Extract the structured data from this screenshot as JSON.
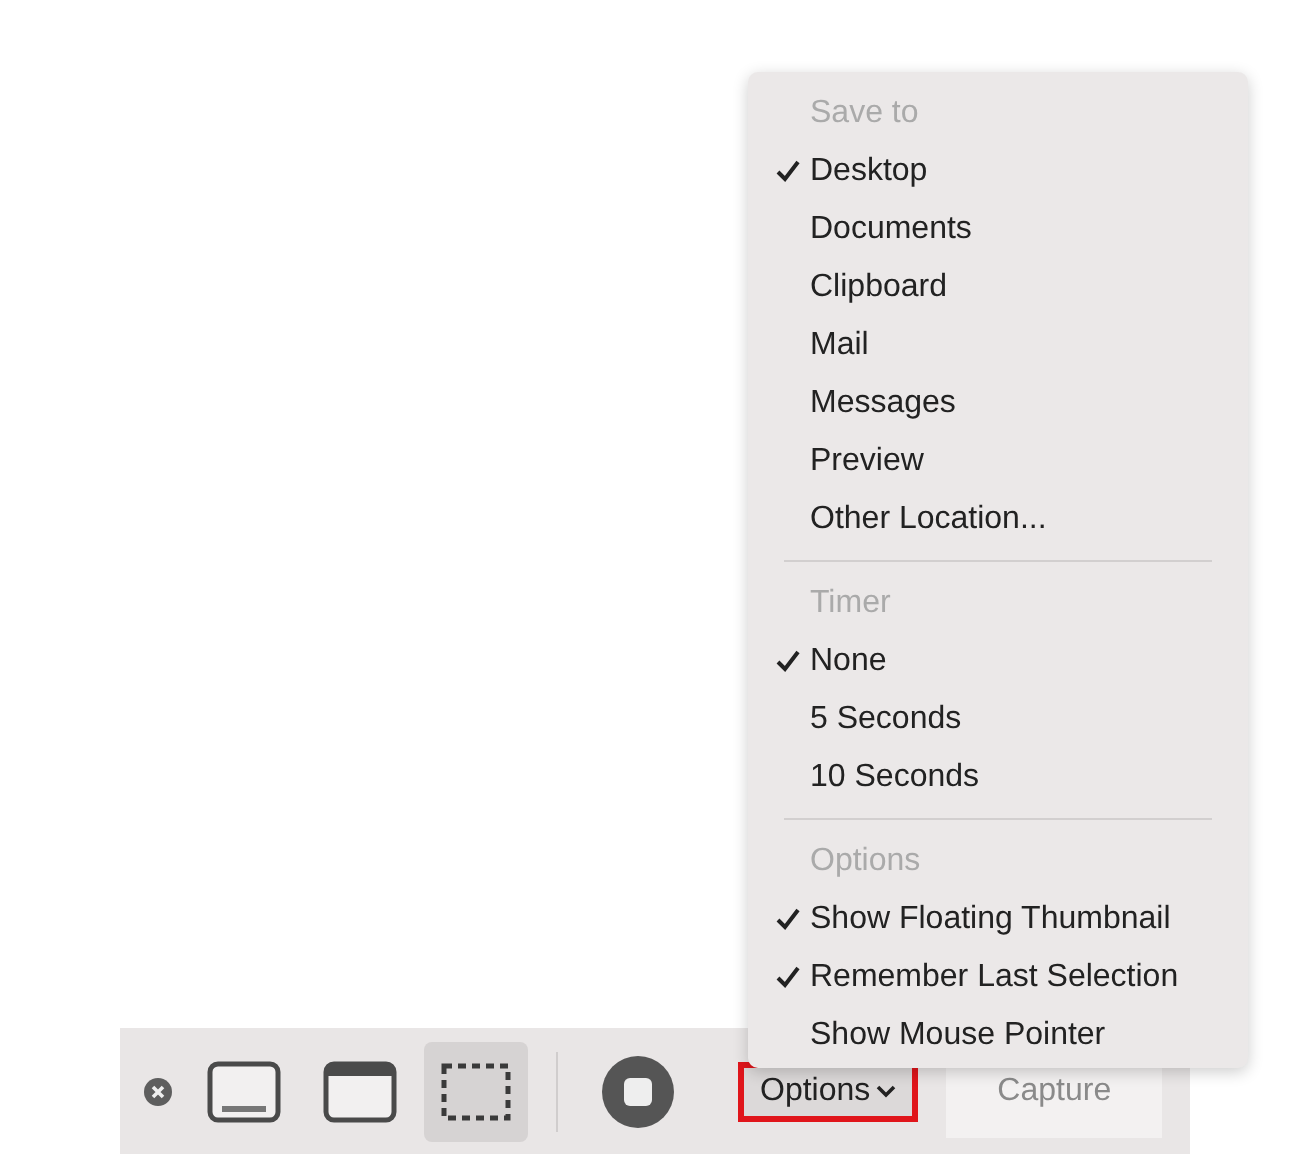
{
  "menu": {
    "sections": [
      {
        "header": "Save to",
        "items": [
          {
            "label": "Desktop",
            "checked": true
          },
          {
            "label": "Documents",
            "checked": false
          },
          {
            "label": "Clipboard",
            "checked": false
          },
          {
            "label": "Mail",
            "checked": false
          },
          {
            "label": "Messages",
            "checked": false
          },
          {
            "label": "Preview",
            "checked": false
          },
          {
            "label": "Other Location...",
            "checked": false
          }
        ]
      },
      {
        "header": "Timer",
        "items": [
          {
            "label": "None",
            "checked": true
          },
          {
            "label": "5 Seconds",
            "checked": false
          },
          {
            "label": "10 Seconds",
            "checked": false
          }
        ]
      },
      {
        "header": "Options",
        "items": [
          {
            "label": "Show Floating Thumbnail",
            "checked": true
          },
          {
            "label": "Remember Last Selection",
            "checked": true
          },
          {
            "label": "Show Mouse Pointer",
            "checked": false
          }
        ]
      }
    ]
  },
  "toolbar": {
    "tools": [
      {
        "kind": "screen",
        "selected": false
      },
      {
        "kind": "window",
        "selected": false
      },
      {
        "kind": "selection",
        "selected": true
      },
      {
        "kind": "record",
        "selected": false
      }
    ],
    "options_button": {
      "label": "Options",
      "highlighted": true
    },
    "capture_button": {
      "label": "Capture",
      "disabled": true
    }
  }
}
